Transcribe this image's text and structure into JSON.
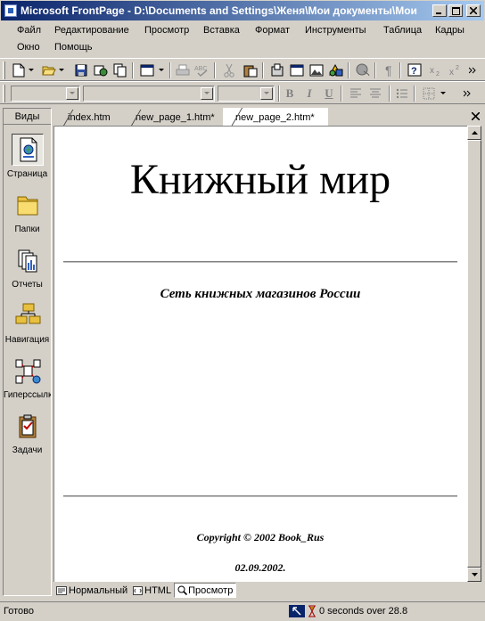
{
  "window": {
    "title": "Microsoft FrontPage - D:\\Documents and Settings\\Женя\\Мои документы\\Мои"
  },
  "menu": {
    "row1": [
      "Файл",
      "Редактирование",
      "Просмотр",
      "Вставка",
      "Формат",
      "Инструменты",
      "Таблица",
      "Кадры"
    ],
    "row2": [
      "Окно",
      "Помощь"
    ]
  },
  "views": {
    "header": "Виды",
    "items": [
      {
        "label": "Страница",
        "icon": "page-view-icon"
      },
      {
        "label": "Папки",
        "icon": "folder-icon"
      },
      {
        "label": "Отчеты",
        "icon": "reports-icon"
      },
      {
        "label": "Навигация",
        "icon": "navigation-icon"
      },
      {
        "label": "Гиперссылки",
        "icon": "hyperlinks-icon"
      },
      {
        "label": "Задачи",
        "icon": "tasks-icon"
      }
    ]
  },
  "tabs": [
    {
      "label": "index.htm"
    },
    {
      "label": "new_page_1.htm*"
    },
    {
      "label": "new_page_2.htm*"
    }
  ],
  "page": {
    "heading": "Книжный мир",
    "subtitle": "Сеть книжных магазинов России",
    "copyright": "Copyright © 2002 Book_Rus",
    "date": "02.09.2002."
  },
  "view_tabs": [
    "Нормальный",
    "HTML",
    "Просмотр"
  ],
  "status": {
    "ready": "Готово",
    "download": "0 seconds over 28.8"
  },
  "format": {
    "bold": "B",
    "italic": "I",
    "underline": "U"
  },
  "colors": {
    "title_active": "#0a246a",
    "title_gradient_end": "#a6caf0",
    "face": "#d4d0c8"
  }
}
